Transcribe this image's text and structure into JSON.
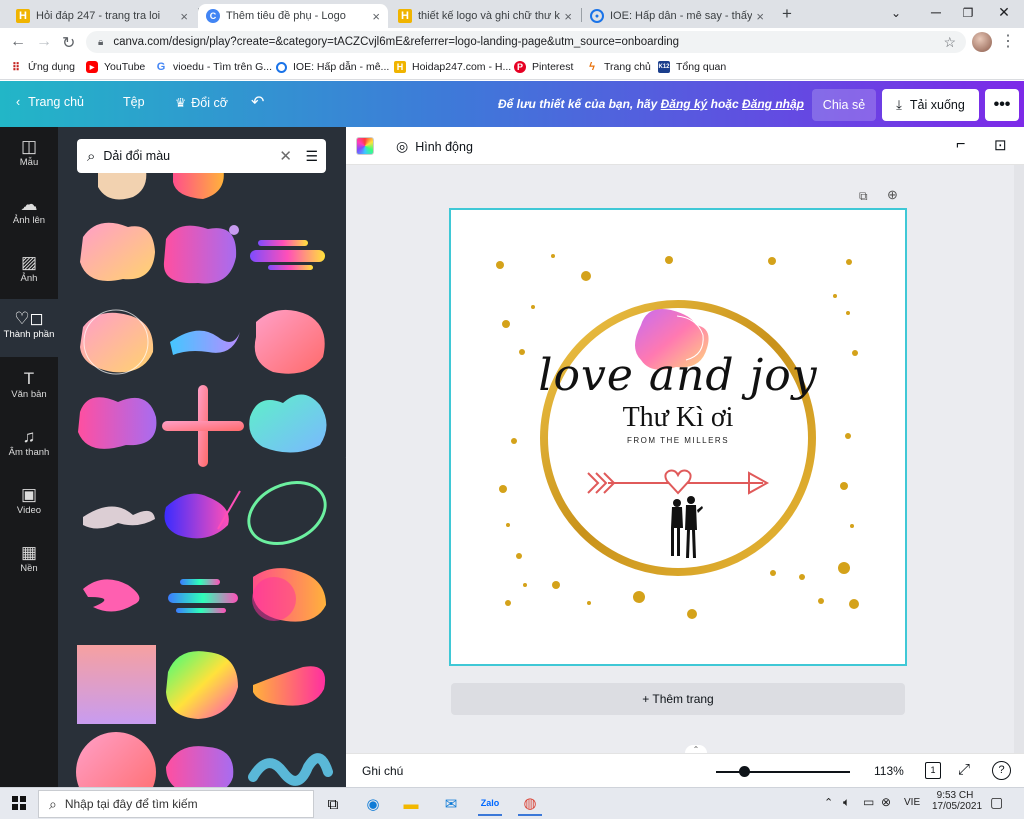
{
  "browser": {
    "tabs": [
      {
        "title": "Hỏi đáp 247 - trang tra loi",
        "favicon": "H"
      },
      {
        "title": "Thêm tiêu đề phụ - Logo",
        "favicon": "C"
      },
      {
        "title": "thiết kế logo và ghi chữ thư kỳ ơi",
        "favicon": "H"
      },
      {
        "title": "IOE: Hấp dẫn - mê say - thấy ngay",
        "favicon": "IOE"
      }
    ],
    "new_tab": "+",
    "close_glyph": "×",
    "url": "canva.com/design/play?create=&category=tACZCvjl6mE&referrer=logo-landing-page&utm_source=onboarding",
    "bookmarks": [
      {
        "label": "Ứng dụng",
        "icon": "apps-icon"
      },
      {
        "label": "YouTube",
        "icon": "youtube-icon"
      },
      {
        "label": "vioedu - Tìm trên G...",
        "icon": "google-icon"
      },
      {
        "label": "IOE: Hấp dẫn - mê...",
        "icon": "ioe-icon"
      },
      {
        "label": "Hoidap247.com - H...",
        "icon": "hoidap-icon"
      },
      {
        "label": "Pinterest",
        "icon": "pinterest-icon"
      },
      {
        "label": "Trang chủ",
        "icon": "home-icon"
      },
      {
        "label": "Tổng quan",
        "icon": "k12-icon"
      }
    ]
  },
  "header": {
    "home": "Trang chủ",
    "file": "Tệp",
    "resize": "Đổi cỡ",
    "note_prefix": "Để lưu thiết kế của bạn, hãy",
    "note_signup": "Đăng ký",
    "note_or": "hoặc",
    "note_login": "Đăng nhập",
    "share": "Chia sẻ",
    "download": "Tải xuống"
  },
  "sidebar": {
    "items": [
      {
        "label": "Mẫu",
        "icon": "template-icon"
      },
      {
        "label": "Ảnh lên",
        "icon": "upload-icon"
      },
      {
        "label": "Ảnh",
        "icon": "photo-icon"
      },
      {
        "label": "Thành phần",
        "icon": "elements-icon"
      },
      {
        "label": "Văn bản",
        "icon": "text-icon"
      },
      {
        "label": "Âm thanh",
        "icon": "audio-icon"
      },
      {
        "label": "Video",
        "icon": "video-icon"
      },
      {
        "label": "Nền",
        "icon": "background-icon"
      }
    ],
    "active": 3
  },
  "panel": {
    "search_value": "Dải đổi màu"
  },
  "toolbar": {
    "animate": "Hình động"
  },
  "design": {
    "script_line": "love and joy",
    "name": "Thư Kì ơi",
    "tagline": "FROM THE MILLERS"
  },
  "canvas": {
    "add_page": "+ Thêm trang"
  },
  "bottom": {
    "notes": "Ghi chú",
    "zoom_percent": 113,
    "zoom_label": "113%",
    "page_count": "1"
  },
  "taskbar": {
    "search_placeholder": "Nhập tại đây để tìm kiếm",
    "language": "VIE",
    "time": "9:53 CH",
    "date": "17/05/2021"
  },
  "colors": {
    "header_start": "#22b6c7",
    "header_end": "#7d2ae8",
    "canvas_outline": "#3fc8d6",
    "gold": "#d4a21a",
    "arrow_red": "#e05a5a"
  }
}
